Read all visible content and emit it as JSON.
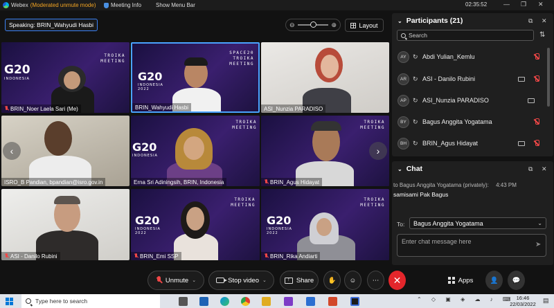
{
  "titlebar": {
    "app_name": "Webex",
    "mode": "(Moderated unmute mode)",
    "meeting_info": "Meeting Info",
    "show_menu_bar": "Show Menu Bar",
    "timer": "02:35:52"
  },
  "top_controls": {
    "speaking": "Speaking: BRIN_Wahyudi Hasbi",
    "layout_label": "Layout"
  },
  "tiles": {
    "t1": "BRIN_Noer Laela Sari (Me)",
    "t2": "BRIN_Wahyudi Hasbi",
    "t3": "ASI_Nunzia PARADISO",
    "t4": "ISRO_B Pandian, bpandian@isro.gov.in",
    "t5": "Erna Sri Adiningsih, BRIN, Indonesia",
    "t6": "BRIN_Agus Hidayat",
    "t7": "ASI - Danilo Rubini",
    "t8": "BRIN_Emi SSP",
    "t9": "BRIN_Rika Andiarti"
  },
  "slide_text": {
    "g20": "G20",
    "indonesia": "INDONESIA",
    "year": "2022",
    "troika": "TROIKA",
    "meeting": "MEETING",
    "space20": "SPACE20"
  },
  "toolbar": {
    "unmute": "Unmute",
    "stop_video": "Stop video",
    "share": "Share",
    "apps": "Apps"
  },
  "participants_panel": {
    "title": "Participants (21)",
    "search_placeholder": "Search",
    "rows": [
      {
        "initials": "AY",
        "name": "Abdi Yulian_Kemlu"
      },
      {
        "initials": "AR",
        "name": "ASI - Danilo Rubini"
      },
      {
        "initials": "AP",
        "name": "ASI_Nunzia PARADISO"
      },
      {
        "initials": "BY",
        "name": "Bagus Anggita Yogatama"
      },
      {
        "initials": "BH",
        "name": "BRIN_Agus Hidayat"
      }
    ]
  },
  "chat_panel": {
    "title": "Chat",
    "meta": "to Bagus Anggita Yogatama (privately):",
    "meta_time": "4:43 PM",
    "message": "samisami Pak Bagus",
    "to_label": "To:",
    "to_value": "Bagus Anggita Yogatama",
    "input_placeholder": "Enter chat message here"
  },
  "taskbar": {
    "search_placeholder": "Type here to search",
    "time": "16:46",
    "date": "22/03/2022"
  }
}
